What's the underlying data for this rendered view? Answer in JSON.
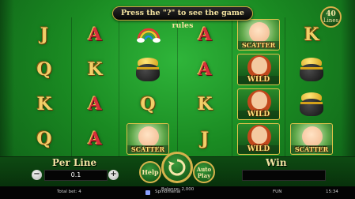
{
  "banner": {
    "text": "Press the \"?\" to see the game rules"
  },
  "lines_badge": {
    "number": "40",
    "label": "Lines"
  },
  "reels": [
    {
      "symbols": [
        "J",
        "Q",
        "K",
        "Q"
      ]
    },
    {
      "symbols": [
        "A",
        "K",
        "A",
        "A"
      ]
    },
    {
      "symbols": [
        "rainbow",
        "pot-of-gold",
        "Q",
        "SCATTER"
      ]
    },
    {
      "symbols": [
        "A",
        "A",
        "K",
        "J"
      ]
    },
    {
      "symbols": [
        "SCATTER",
        "WILD",
        "WILD",
        "WILD"
      ]
    },
    {
      "symbols": [
        "K",
        "pot-of-gold",
        "pot-of-gold",
        "SCATTER"
      ]
    }
  ],
  "controls": {
    "per_line_label": "Per Line",
    "per_line_value": "0.1",
    "minus": "−",
    "plus": "+",
    "help_label": "Help",
    "auto_label_1": "Auto",
    "auto_label_2": "Play",
    "win_label": "Win",
    "win_value": ""
  },
  "footer": {
    "total_bet": "Total bet: 4",
    "provider": "Spinomenal",
    "balance": "Balance: 2,000",
    "mode": "FUN",
    "clock": "15:34"
  },
  "colors": {
    "accent_gold": "#d6b34c",
    "felt_green": "#1a8a22"
  }
}
